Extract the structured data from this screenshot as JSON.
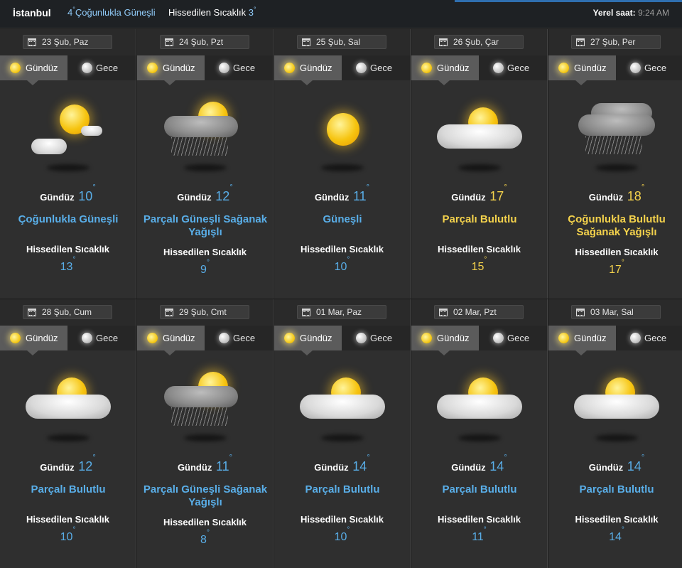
{
  "header": {
    "city": "İstanbul",
    "current_temp": "4",
    "current_condition": "Çoğunlukla Güneşli",
    "feels_label": "Hissedilen Sıcaklık",
    "feels_value": "3",
    "local_time_label": "Yerel saat:",
    "local_time": "9:24 AM"
  },
  "labels": {
    "day_tab": "Gündüz",
    "night_tab": "Gece",
    "daytime": "Gündüz",
    "feels": "Hissedilen Sıcaklık"
  },
  "accent_colors": {
    "cool": "#59aee8",
    "warm": "#f4d24c"
  },
  "days": [
    {
      "date": "23 Şub, Paz",
      "temp": "10",
      "condition": "Çoğunlukla Güneşli",
      "feels": "13",
      "warm": false,
      "icon": "sun-with-small-cloud-icon"
    },
    {
      "date": "24 Şub, Pzt",
      "temp": "12",
      "condition": "Parçalı Güneşli Sağanak Yağışlı",
      "feels": "9",
      "warm": false,
      "icon": "sun-rain-cloud-icon"
    },
    {
      "date": "25 Şub, Sal",
      "temp": "11",
      "condition": "Güneşli",
      "feels": "10",
      "warm": false,
      "icon": "sun-icon"
    },
    {
      "date": "26 Şub, Çar",
      "temp": "17",
      "condition": "Parçalı Bulutlu",
      "feels": "15",
      "warm": true,
      "icon": "sun-behind-cloud-icon"
    },
    {
      "date": "27 Şub, Per",
      "temp": "18",
      "condition": "Çoğunlukla Bulutlu Sağanak Yağışlı",
      "feels": "17",
      "warm": true,
      "icon": "dark-rain-cloud-icon"
    },
    {
      "date": "28 Şub, Cum",
      "temp": "12",
      "condition": "Parçalı Bulutlu",
      "feels": "10",
      "warm": false,
      "icon": "sun-behind-cloud-icon"
    },
    {
      "date": "29 Şub, Cmt",
      "temp": "11",
      "condition": "Parçalı Güneşli Sağanak Yağışlı",
      "feels": "8",
      "warm": false,
      "icon": "sun-rain-cloud-icon"
    },
    {
      "date": "01 Mar, Paz",
      "temp": "14",
      "condition": "Parçalı Bulutlu",
      "feels": "10",
      "warm": false,
      "icon": "sun-behind-cloud-icon"
    },
    {
      "date": "02 Mar, Pzt",
      "temp": "14",
      "condition": "Parçalı Bulutlu",
      "feels": "11",
      "warm": false,
      "icon": "sun-behind-cloud-icon"
    },
    {
      "date": "03 Mar, Sal",
      "temp": "14",
      "condition": "Parçalı Bulutlu",
      "feels": "14",
      "warm": false,
      "icon": "sun-behind-cloud-icon"
    }
  ]
}
